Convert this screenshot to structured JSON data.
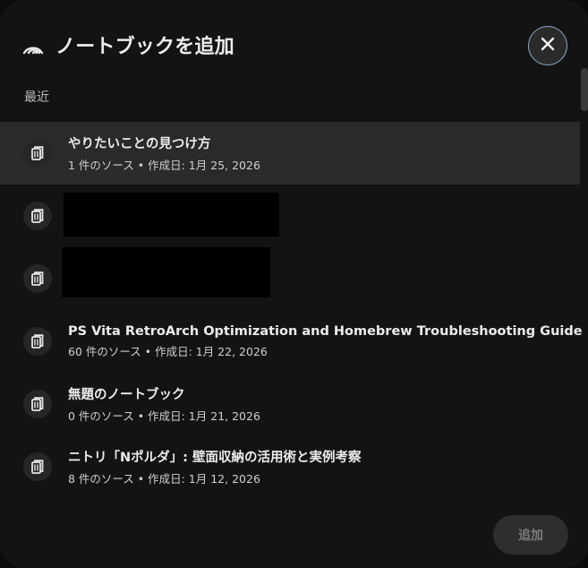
{
  "dialog": {
    "title": "ノートブックを追加",
    "section_label": "最近",
    "add_button_label": "追加"
  },
  "notebooks": [
    {
      "title": "やりたいことの見つけ方",
      "meta": "1 件のソース • 作成日: 1月 25, 2026"
    },
    {
      "title": "PS Vita RetroArch Optimization and Homebrew Troubleshooting Guide",
      "meta": "60 件のソース • 作成日: 1月 22, 2026"
    },
    {
      "title": "無題のノートブック",
      "meta": "0 件のソース • 作成日: 1月 21, 2026"
    },
    {
      "title": "ニトリ「Nポルダ」: 壁面収納の活用術と実例考察",
      "meta": "8 件のソース • 作成日: 1月 12, 2026"
    }
  ],
  "icons": {
    "header": "source-share-icon",
    "close": "close-icon",
    "notebook": "notebook-icon"
  },
  "colors": {
    "dialog_bg": "#131313",
    "selected_row_bg": "#2a2a2a",
    "close_border": "#8fa7c7",
    "disabled_button_bg": "#2e2e2e"
  }
}
